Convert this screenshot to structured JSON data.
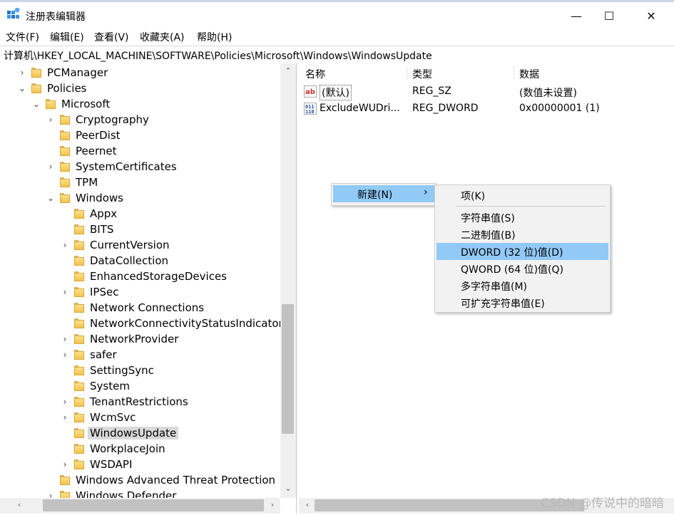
{
  "window": {
    "title": "注册表编辑器",
    "minimize_icon": "—",
    "maximize_icon": "☐",
    "close_icon": "✕"
  },
  "menu": [
    "文件(F)",
    "编辑(E)",
    "查看(V)",
    "收藏夹(A)",
    "帮助(H)"
  ],
  "address": "计算机\\HKEY_LOCAL_MACHINE\\SOFTWARE\\Policies\\Microsoft\\Windows\\WindowsUpdate",
  "tree": [
    {
      "label": "PCManager",
      "chev": "›"
    },
    {
      "label": "Policies",
      "chev": "⌄"
    },
    {
      "label": "Microsoft",
      "chev": "⌄"
    },
    {
      "label": "Cryptography",
      "chev": "›"
    },
    {
      "label": "PeerDist",
      "chev": ""
    },
    {
      "label": "Peernet",
      "chev": ""
    },
    {
      "label": "SystemCertificates",
      "chev": "›"
    },
    {
      "label": "TPM",
      "chev": ""
    },
    {
      "label": "Windows",
      "chev": "⌄"
    },
    {
      "label": "Appx",
      "chev": ""
    },
    {
      "label": "BITS",
      "chev": ""
    },
    {
      "label": "CurrentVersion",
      "chev": "›"
    },
    {
      "label": "DataCollection",
      "chev": ""
    },
    {
      "label": "EnhancedStorageDevices",
      "chev": ""
    },
    {
      "label": "IPSec",
      "chev": "›"
    },
    {
      "label": "Network Connections",
      "chev": ""
    },
    {
      "label": "NetworkConnectivityStatusIndicator",
      "chev": ""
    },
    {
      "label": "NetworkProvider",
      "chev": "›"
    },
    {
      "label": "safer",
      "chev": "›"
    },
    {
      "label": "SettingSync",
      "chev": ""
    },
    {
      "label": "System",
      "chev": ""
    },
    {
      "label": "TenantRestrictions",
      "chev": "›"
    },
    {
      "label": "WcmSvc",
      "chev": "›"
    },
    {
      "label": "WindowsUpdate",
      "chev": ""
    },
    {
      "label": "WorkplaceJoin",
      "chev": ""
    },
    {
      "label": "WSDAPI",
      "chev": "›"
    },
    {
      "label": "Windows Advanced Threat Protection",
      "chev": ""
    },
    {
      "label": "Windows Defender",
      "chev": "›"
    }
  ],
  "columns": {
    "name": "名称",
    "type": "类型",
    "data": "数据"
  },
  "values": [
    {
      "name": "(默认)",
      "type": "REG_SZ",
      "data": "(数值未设置)",
      "icon": "string-value-icon"
    },
    {
      "name": "ExcludeWUDri...",
      "type": "REG_DWORD",
      "data": "0x00000001 (1)",
      "icon": "dword-value-icon"
    }
  ],
  "context_menu": {
    "new_label": "新建(N)",
    "submenu_arrow": "›",
    "submenu": [
      "项(K)",
      "字符串值(S)",
      "二进制值(B)",
      "DWORD (32 位)值(D)",
      "QWORD (64 位)值(Q)",
      "多字符串值(M)",
      "可扩充字符串值(E)"
    ],
    "highlighted_item": "DWORD (32 位)值(D)"
  },
  "scroll_arrows": {
    "up": "⌃",
    "down": "⌄",
    "left": "‹",
    "right": "›"
  },
  "watermark": "CSDN @传说中的暗暗",
  "colors": {
    "highlight": "#91c9f7",
    "selection": "#d9d9d9",
    "folder": "#f3c34d"
  }
}
